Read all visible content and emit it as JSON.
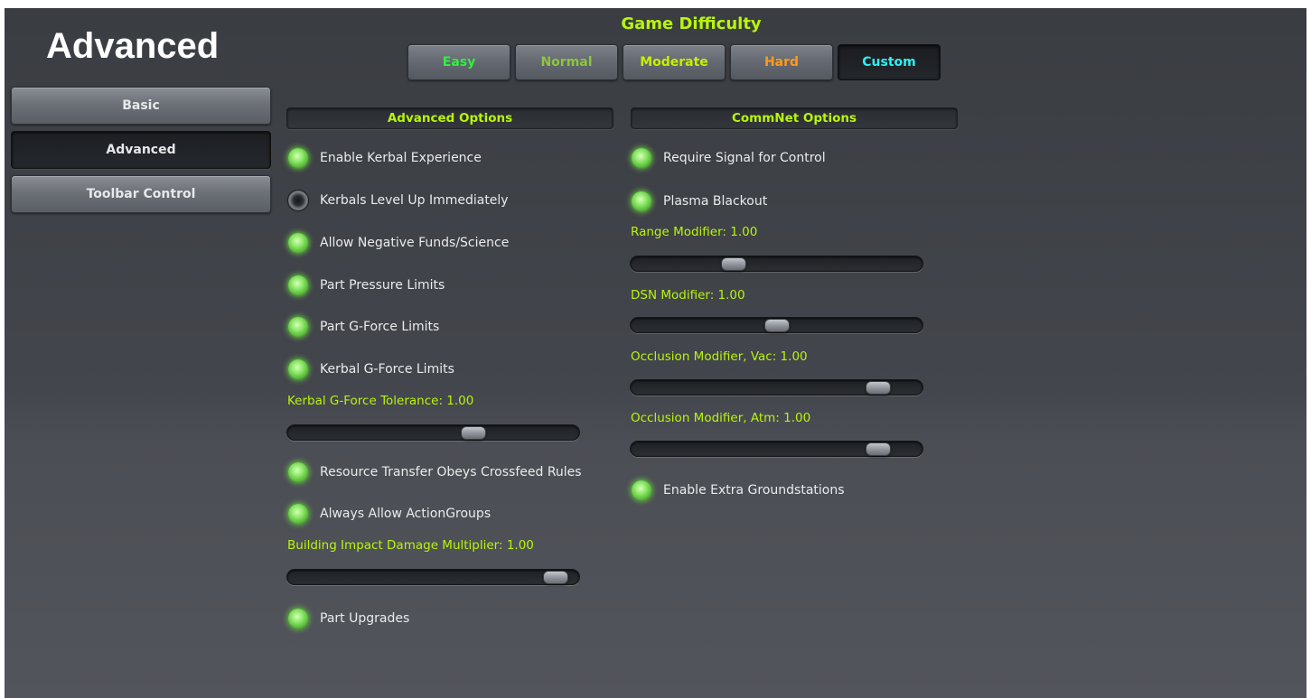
{
  "page": {
    "title": "Advanced"
  },
  "nav": {
    "items": [
      {
        "label": "Basic"
      },
      {
        "label": "Advanced"
      },
      {
        "label": "Toolbar Control"
      }
    ]
  },
  "difficulty": {
    "title": "Game Difficulty",
    "options": [
      {
        "label": "Easy",
        "color": "#33ee44"
      },
      {
        "label": "Normal",
        "color": "#8dc63f"
      },
      {
        "label": "Moderate",
        "color": "#c6f000"
      },
      {
        "label": "Hard",
        "color": "#ff9a1a"
      },
      {
        "label": "Custom",
        "color": "#2ef0f0"
      }
    ],
    "selected": "Custom"
  },
  "advanced_options": {
    "header": "Advanced Options",
    "toggles": [
      {
        "label": "Enable Kerbal Experience",
        "on": true
      },
      {
        "label": "Kerbals Level Up Immediately",
        "on": false
      },
      {
        "label": "Allow Negative Funds/Science",
        "on": true
      },
      {
        "label": "Part Pressure Limits",
        "on": true
      },
      {
        "label": "Part G-Force Limits",
        "on": true
      },
      {
        "label": "Kerbal G-Force Limits",
        "on": true
      },
      {
        "label": "Resource Transfer Obeys Crossfeed Rules",
        "on": true
      },
      {
        "label": "Always Allow ActionGroups",
        "on": true
      },
      {
        "label": "Part Upgrades",
        "on": true
      }
    ],
    "sliders": [
      {
        "label": "Kerbal G-Force Tolerance: 1.00",
        "value": 0.65
      },
      {
        "label": "Building Impact Damage Multiplier: 1.00",
        "value": 0.96
      }
    ]
  },
  "commnet_options": {
    "header": "CommNet Options",
    "toggles": [
      {
        "label": "Require Signal for Control",
        "on": true
      },
      {
        "label": "Plasma Blackout",
        "on": true
      },
      {
        "label": "Enable Extra Groundstations",
        "on": true
      }
    ],
    "sliders": [
      {
        "label": "Range Modifier: 1.00",
        "value": 0.34
      },
      {
        "label": "DSN Modifier: 1.00",
        "value": 0.5
      },
      {
        "label": "Occlusion Modifier, Vac: 1.00",
        "value": 0.88
      },
      {
        "label": "Occlusion Modifier, Atm: 1.00",
        "value": 0.88
      }
    ]
  },
  "colors": {
    "accent": "#b9f50a",
    "text": "#e9ebec",
    "led_on": "#7fe04f",
    "background": "#43464c"
  }
}
